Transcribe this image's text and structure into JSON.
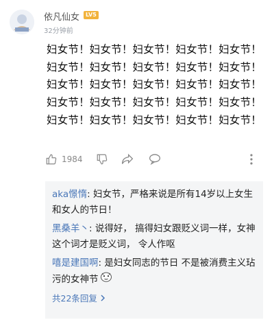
{
  "post": {
    "username": "依凡仙女",
    "badge": "LV5",
    "timestamp": "32分钟前",
    "comment_text": "妇女节！妇女节！妇女节！妇女节！妇女节！妇女节！妇女节！妇女节！妇女节！妇女节！妇女节！妇女节！妇女节！妇女节！妇女节！妇女节！妇女节！妇女节！妇女节！妇女节！妇女节！妇女节！妇女节！妇女节！妇女节！"
  },
  "actions": {
    "like_count": "1984",
    "icons": [
      "thumbs-up-icon",
      "thumbs-down-icon",
      "share-icon",
      "reply-icon",
      "more-icon"
    ]
  },
  "replies": [
    {
      "author": "aka憬惰",
      "separator": ": ",
      "text": "妇女节，严格来说是所有14岁以上女生和女人的节日！"
    },
    {
      "author": "黑桑羊丶",
      "separator": ": ",
      "text": "说得好， 搞得妇女跟贬义词一样，女神这个词才是贬义词， 令人作呕"
    },
    {
      "author": "嘻是建国啊",
      "separator": ": ",
      "text": "是妇女同志的节日 不是被消费主义玷污的女神节"
    }
  ],
  "view_all_label": "共22条回复",
  "colors": {
    "link_blue": "#4a77b8",
    "badge_orange": "#f2b33c",
    "reply_bg": "#f4f5f6"
  }
}
